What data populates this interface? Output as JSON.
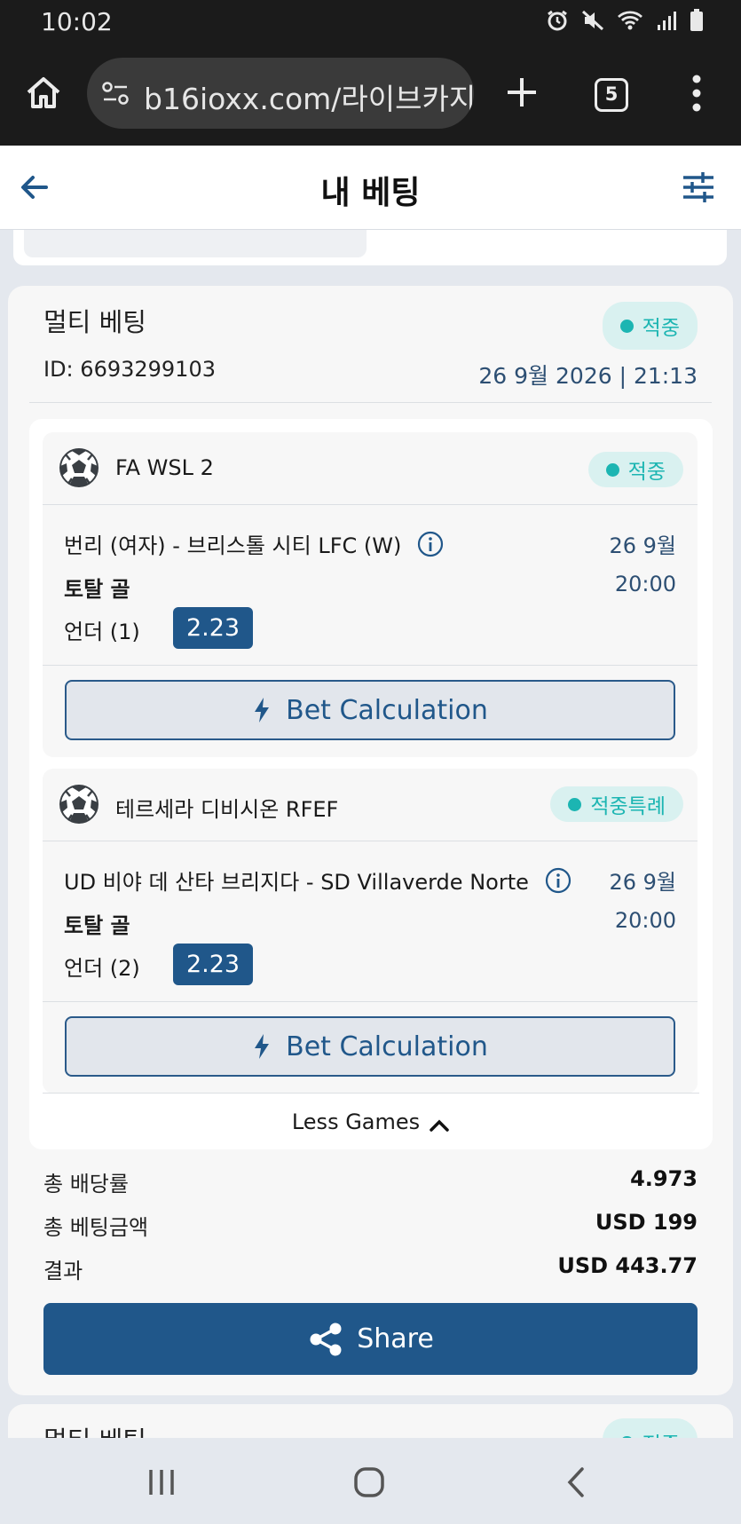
{
  "status_bar": {
    "time": "10:02",
    "icons": [
      "alarm-icon",
      "mute-icon",
      "wifi-icon",
      "signal-icon",
      "battery-icon"
    ]
  },
  "browser": {
    "url": "b16ioxx.com/라이브카지",
    "tab_count": "5"
  },
  "header": {
    "title": "내 베팅"
  },
  "bet": {
    "type": "멀티 베팅",
    "status": "적중",
    "id_label": "ID:",
    "id": "6693299103",
    "date": "26 9월 2026 | 21:13",
    "games": [
      {
        "league": "FA WSL 2",
        "status": "적중",
        "match": "번리 (여자) - 브리스톨 시티 LFC (W)",
        "date": "26 9월",
        "time": "20:00",
        "market": "토탈 골",
        "pick": "언더 (1)",
        "odds": "2.23",
        "calc_label": "Bet Calculation"
      },
      {
        "league": "테르세라 디비시온 RFEF",
        "status": "적중특례",
        "match": "UD 비야 데 산타 브리지다 - SD Villaverde Norte",
        "date": "26 9월",
        "time": "20:00",
        "market": "토탈 골",
        "pick": "언더 (2)",
        "odds": "2.23",
        "calc_label": "Bet Calculation"
      }
    ],
    "less_games": "Less Games",
    "summary": {
      "total_odds_label": "총 배당률",
      "total_odds": "4.973",
      "total_stake_label": "총 베팅금액",
      "total_stake": "USD 199",
      "result_label": "결과",
      "result": "USD 443.77"
    },
    "share_label": "Share"
  },
  "next_bet": {
    "type": "멀티 베팅",
    "status": "적중"
  },
  "colors": {
    "primary": "#20578a",
    "badge_text": "#1cb5b2",
    "badge_bg": "#d9f1f0",
    "date_text": "#2d4f73"
  }
}
